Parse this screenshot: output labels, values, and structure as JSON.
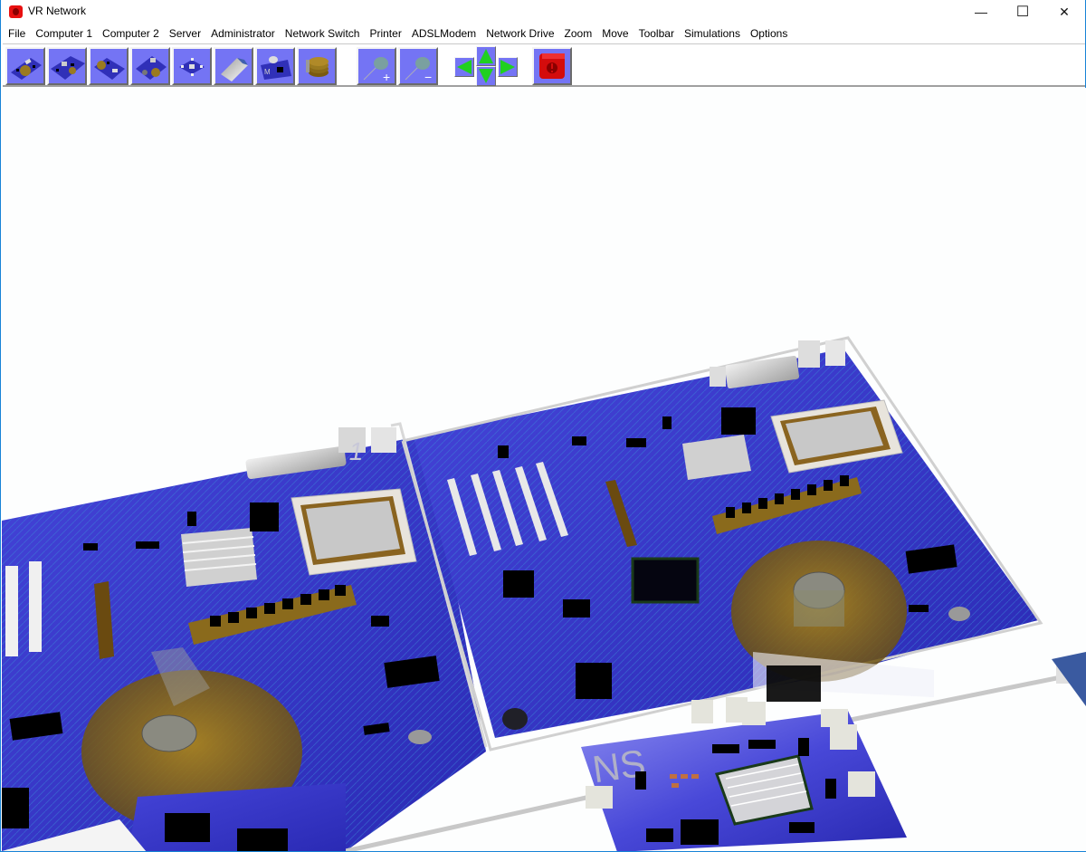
{
  "window": {
    "title": "VR Network",
    "controls": {
      "minimize": "—",
      "maximize": "☐",
      "close": "✕"
    }
  },
  "menu": [
    "File",
    "Computer 1",
    "Computer 2",
    "Server",
    "Administrator",
    "Network Switch",
    "Printer",
    "ADSLModem",
    "Network Drive",
    "Zoom",
    "Move",
    "Toolbar",
    "Simulations",
    "Options"
  ],
  "toolbar": {
    "device_buttons": [
      {
        "name": "computer-1-button",
        "icon": "motherboard-with-disk-icon"
      },
      {
        "name": "computer-2-button",
        "icon": "motherboard-icon"
      },
      {
        "name": "server-button",
        "icon": "server-board-icon"
      },
      {
        "name": "administrator-button",
        "icon": "admin-board-icon"
      },
      {
        "name": "network-switch-button",
        "icon": "network-switch-icon"
      },
      {
        "name": "printer-button",
        "icon": "printer-plate-icon"
      },
      {
        "name": "adsl-modem-button",
        "icon": "modem-board-icon"
      },
      {
        "name": "network-drive-button",
        "icon": "disk-stack-icon"
      }
    ],
    "zoom_in_symbol": "+",
    "zoom_out_symbol": "−",
    "move_buttons": [
      "left",
      "up",
      "down",
      "right"
    ],
    "simulation_button": {
      "name": "simulation-stop-button",
      "icon": "red-alert-icon"
    }
  },
  "scene": {
    "board_1_label": "1",
    "switch_label": "NS",
    "colors": {
      "board": "#3232c8",
      "board_light": "#5050e0",
      "trace": "#3a8ad8",
      "chip": "#050510",
      "metal": "#c8c8c8",
      "disk": "#a07818",
      "toolbar_button": "#7474f4",
      "arrow_green": "#20d020",
      "alert_red": "#e01010"
    }
  }
}
